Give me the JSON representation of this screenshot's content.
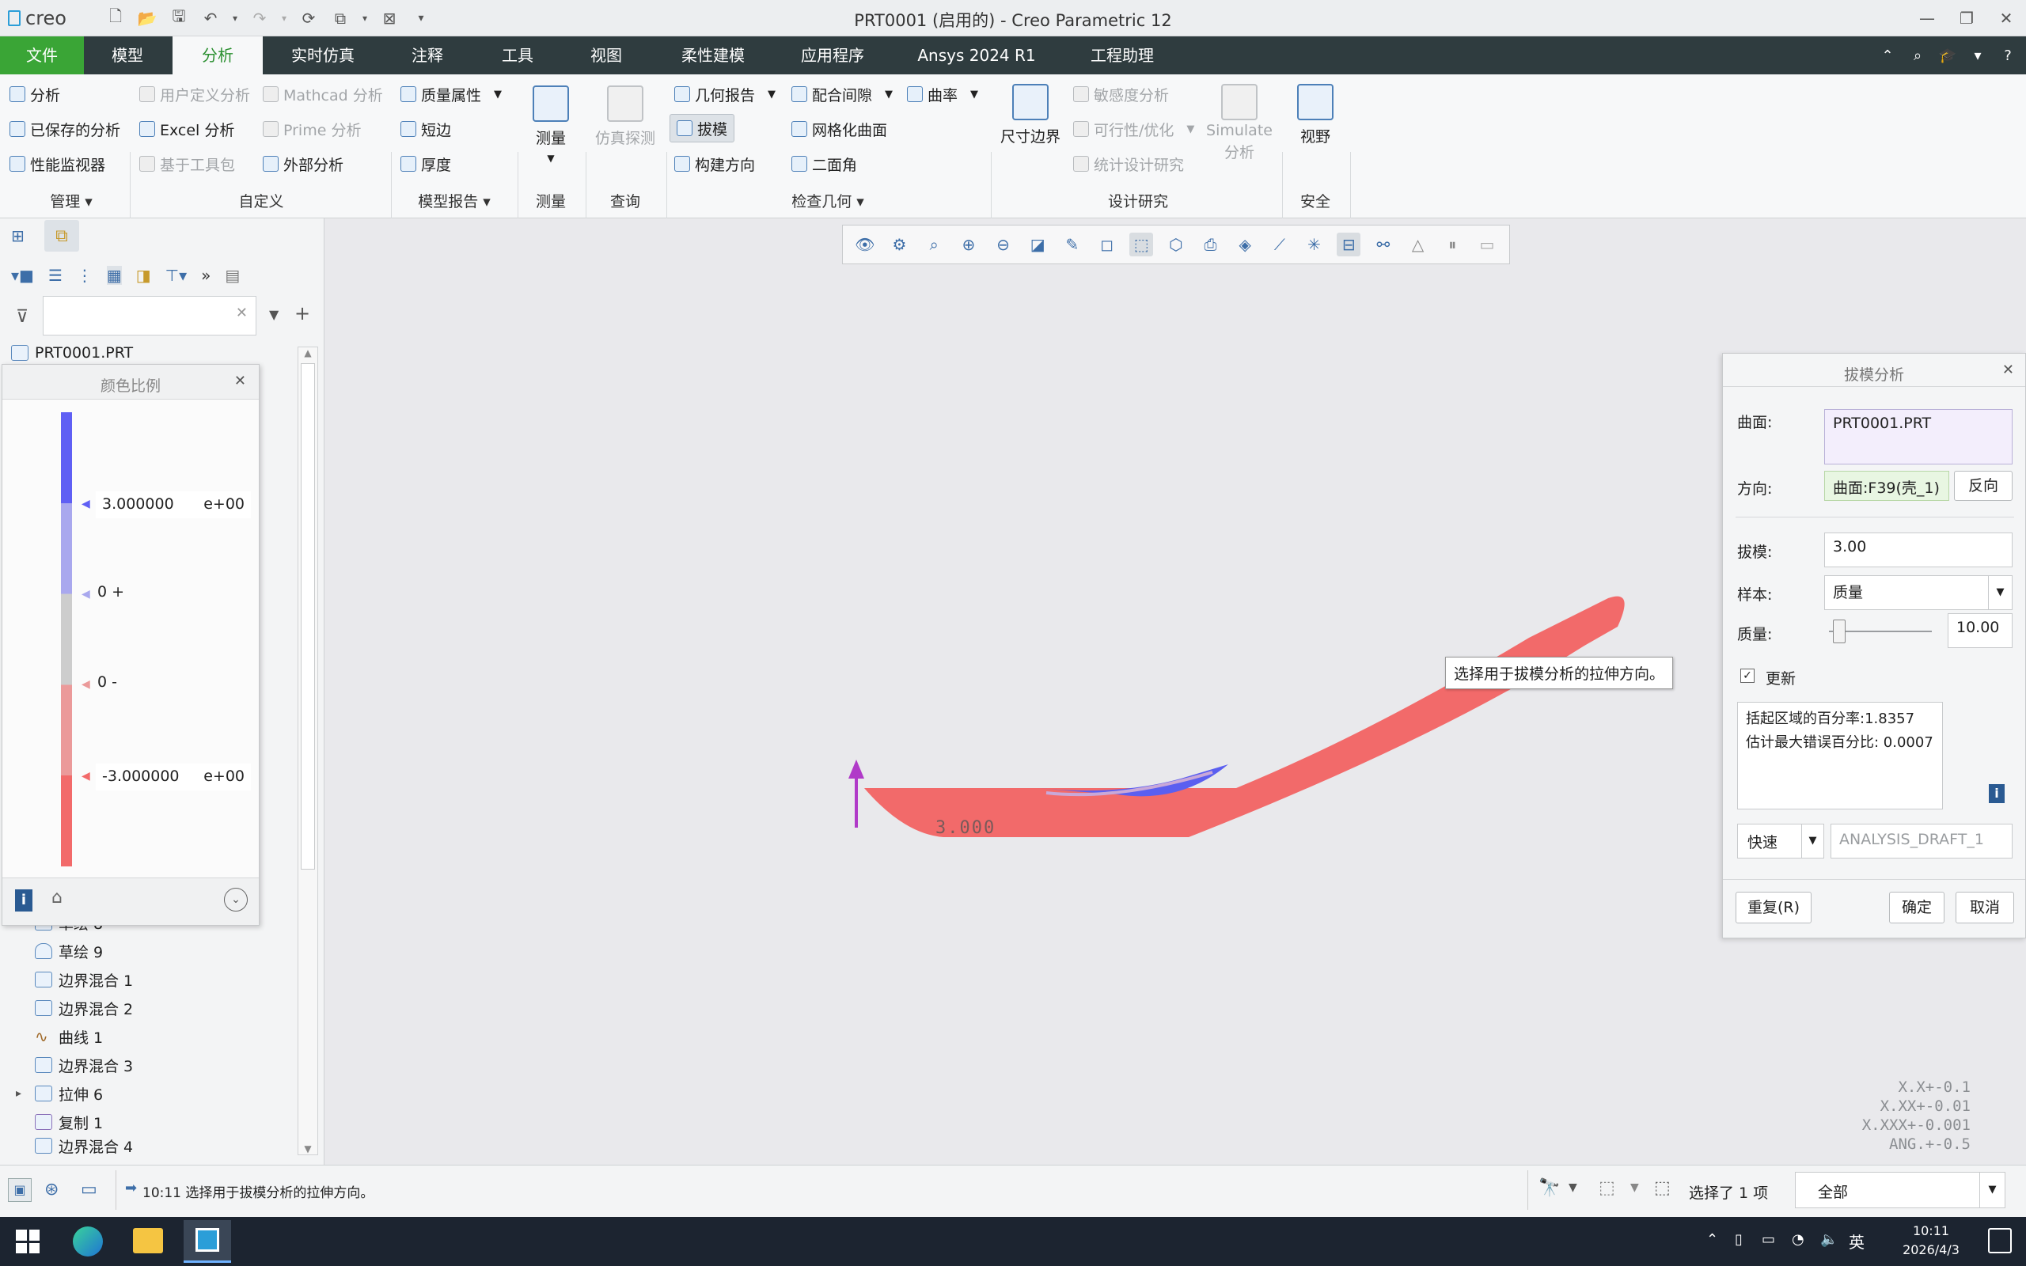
{
  "app": {
    "logo_text": "creo",
    "window_title": "PRT0001 (启用的) - Creo Parametric 12"
  },
  "tabs": [
    {
      "label": "文件"
    },
    {
      "label": "模型"
    },
    {
      "label": "分析"
    },
    {
      "label": "实时仿真"
    },
    {
      "label": "注释"
    },
    {
      "label": "工具"
    },
    {
      "label": "视图"
    },
    {
      "label": "柔性建模"
    },
    {
      "label": "应用程序"
    },
    {
      "label": "Ansys 2024 R1"
    },
    {
      "label": "工程助理"
    }
  ],
  "ribbon": {
    "manage": {
      "items": [
        "分析",
        "已保存的分析",
        "性能监视器"
      ],
      "group": "管理"
    },
    "custom": {
      "items": [
        "用户定义分析",
        "Excel 分析",
        "基于工具包",
        "Mathcad 分析",
        "Prime 分析",
        "外部分析"
      ],
      "group": "自定义"
    },
    "model_report": {
      "items": [
        "质量属性",
        "短边",
        "厚度"
      ],
      "group": "模型报告"
    },
    "measure": {
      "label": "测量",
      "group": "测量"
    },
    "query": {
      "label": "仿真探测",
      "group": "查询"
    },
    "inspect": {
      "items": [
        "几何报告",
        "拔模",
        "构建方向",
        "配合间隙",
        "网格化曲面",
        "二面角",
        "曲率"
      ],
      "group": "检查几何"
    },
    "design_study": {
      "dim_boundary": "尺寸边界",
      "items": [
        "敏感度分析",
        "可行性/优化",
        "统计设计研究"
      ],
      "simulate_line1": "Simulate",
      "simulate_line2": "分析",
      "group": "设计研究"
    },
    "safety": {
      "label": "视野",
      "group": "安全"
    }
  },
  "model_tree": {
    "root": "PRT0001.PRT",
    "items": [
      "草绘 8",
      "草绘 9",
      "边界混合 1",
      "边界混合 2",
      "曲线 1",
      "边界混合 3",
      "拉伸 6",
      "复制 1",
      "边界混合 4"
    ]
  },
  "color_scale": {
    "title": "颜色比例",
    "top_value": "3.000000",
    "top_exp": "e+00",
    "zero_plus": "0 +",
    "zero_minus": "0 -",
    "bottom_value": "-3.000000",
    "bottom_exp": "e+00"
  },
  "draft_dialog": {
    "title": "拔模分析",
    "surface_label": "曲面:",
    "surface_value": "PRT0001.PRT",
    "direction_label": "方向:",
    "direction_value": "曲面:F39(壳_1)",
    "flip_button": "反向",
    "draft_label": "拔模:",
    "draft_value": "3.00",
    "sample_label": "样本:",
    "sample_value": "质量",
    "quality_label": "质量:",
    "quality_value": "10.00",
    "quality_fraction": 0.04,
    "update_label": "更新",
    "result_line1": "括起区域的百分率:1.8357",
    "result_line2": "估计最大错误百分比: 0.0007",
    "mode_value": "快速",
    "analysis_name": "ANALYSIS_DRAFT_1",
    "repeat_button": "重复(R)",
    "ok_button": "确定",
    "cancel_button": "取消"
  },
  "graphics": {
    "draft_label": "3.000",
    "tooltip": "选择用于拔模分析的拉伸方向。",
    "tolerance": [
      "X.X+-0.1",
      "X.XX+-0.01",
      "X.XXX+-0.001",
      "ANG.+-0.5"
    ]
  },
  "status": {
    "message": "10:11 选择用于拔模分析的拉伸方向。",
    "selection": "选择了 1 项",
    "filter_value": "全部"
  },
  "taskbar": {
    "ime": "英",
    "time": "10:11",
    "date": "2026/4/3"
  },
  "colors": {
    "accent_green": "#3aa536",
    "tab_bar": "#2f3c3f",
    "positive_draft": "#5b5ff0",
    "negative_draft": "#f26a6a"
  }
}
